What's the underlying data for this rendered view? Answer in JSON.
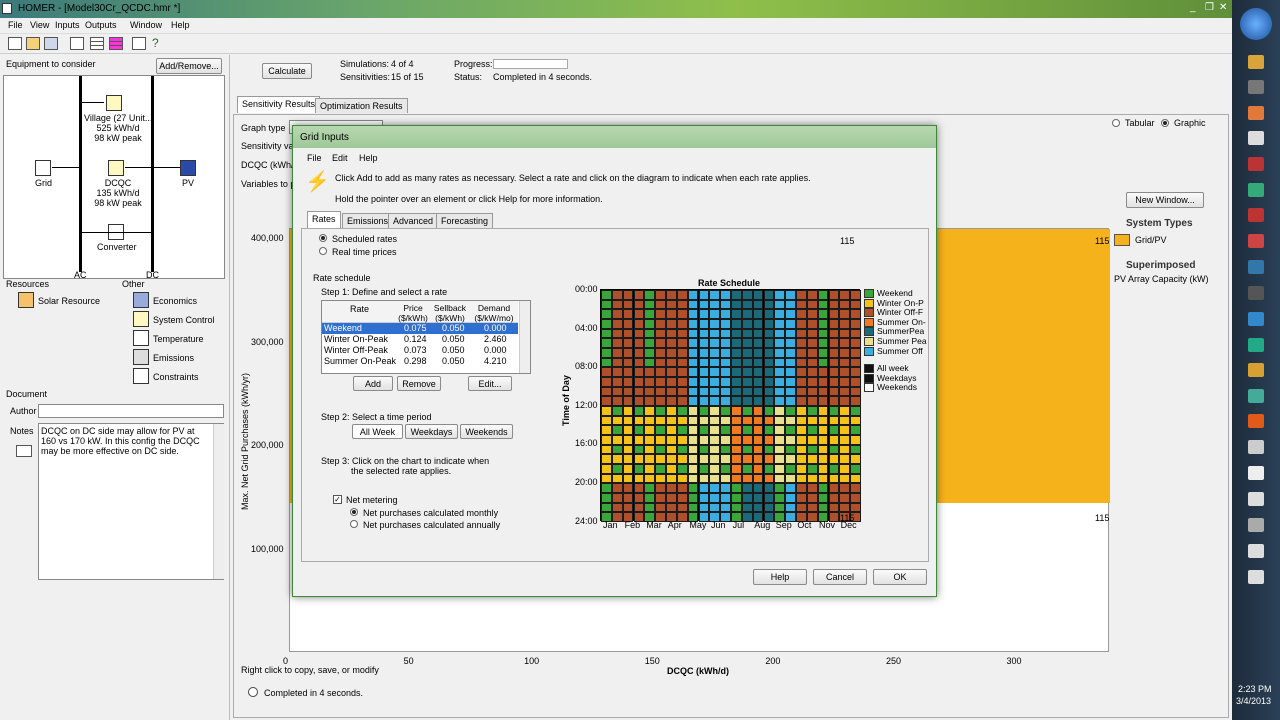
{
  "window": {
    "title": "HOMER - [Model30Cr_QCDC.hmr *]"
  },
  "menu": [
    "File",
    "View",
    "Inputs",
    "Outputs",
    "Window",
    "Help"
  ],
  "left": {
    "equipment_label": "Equipment to consider",
    "add_remove": "Add/Remove...",
    "nodes": {
      "village": [
        "Village (27 Unit...",
        "525 kWh/d",
        "98 kW peak"
      ],
      "dcqc": [
        "DCQC",
        "135 kWh/d",
        "98 kW peak"
      ],
      "grid": "Grid",
      "pv": "PV",
      "converter": "Converter",
      "ac": "AC",
      "dc": "DC"
    },
    "resources_label": "Resources",
    "other_label": "Other",
    "resources": [
      "Solar Resource"
    ],
    "other": [
      "Economics",
      "System Control",
      "Temperature",
      "Emissions",
      "Constraints"
    ],
    "document_label": "Document",
    "author_label": "Author",
    "notes_label": "Notes",
    "notes_text": "DCQC on DC side may allow for PV at 160 vs 170 kW.  In this config the DCQC may be more effective on DC side."
  },
  "top": {
    "calculate": "Calculate",
    "simulations_label": "Simulations:",
    "simulations": "4 of 4",
    "sensitivities_label": "Sensitivities:",
    "sensitivities": "15 of 15",
    "progress_label": "Progress:",
    "status_label": "Status:",
    "status": "Completed in 4 seconds."
  },
  "results": {
    "tabs": [
      "Sensitivity Results",
      "Optimization Results"
    ],
    "graph_type_label": "Graph type",
    "sens_var_label": "Sensitivity var",
    "dcqc_label": "DCQC (kWh/",
    "vars_plot_label": "Variables to pl",
    "view_tabular": "Tabular",
    "view_graphic": "Graphic",
    "new_window": "New Window...",
    "system_types_title": "System Types",
    "system_types": [
      "Grid/PV"
    ],
    "superimposed_title": "Superimposed",
    "superimposed_value": "PV Array Capacity (kW)",
    "footer_hint": "Right click to copy, save, or modify",
    "status_bar": "Completed in 4 seconds."
  },
  "chart_data": {
    "type": "area",
    "xlabel": "DCQC (kWh/d)",
    "ylabel": "Max. Net Grid Purchases (kWh/yr)",
    "x_ticks": [
      "0",
      "50",
      "100",
      "150",
      "200",
      "250",
      "300"
    ],
    "y_ticks": [
      "100,000",
      "200,000",
      "300,000",
      "400,000"
    ],
    "xlim": [
      0,
      340
    ],
    "ylim": [
      0,
      410000
    ],
    "series": [
      {
        "name": "Grid/PV",
        "color": "#f5b21a"
      }
    ],
    "contour_labels": [
      "115",
      "115",
      "115",
      "115"
    ]
  },
  "dialog": {
    "title": "Grid Inputs",
    "menu": [
      "File",
      "Edit",
      "Help"
    ],
    "hint1": "Click Add to add as many rates as necessary.  Select a rate and click on the diagram to indicate when each rate applies.",
    "hint2": "Hold the pointer over an element or click Help for more information.",
    "tabs": [
      "Rates",
      "Emissions",
      "Advanced",
      "Forecasting"
    ],
    "scheduled": "Scheduled rates",
    "realtime": "Real time prices",
    "rate_schedule": "Rate schedule",
    "step1": "Step 1:  Define and select a rate",
    "table_headers": [
      "Rate",
      "Price ($/kWh)",
      "Sellback ($/kWh)",
      "Demand ($/kW/mo)"
    ],
    "rates": [
      [
        "Weekend",
        "0.075",
        "0.050",
        "0.000"
      ],
      [
        "Winter On-Peak",
        "0.124",
        "0.050",
        "2.460"
      ],
      [
        "Winter Off-Peak",
        "0.073",
        "0.050",
        "0.000"
      ],
      [
        "Summer On-Peak",
        "0.298",
        "0.050",
        "4.210"
      ]
    ],
    "add": "Add",
    "remove": "Remove",
    "edit": "Edit...",
    "step2": "Step 2:  Select a time period",
    "periods": [
      "All Week",
      "Weekdays",
      "Weekends"
    ],
    "step3a": "Step 3:  Click on the chart to indicate when",
    "step3b": "the selected rate applies.",
    "net_metering": "Net metering",
    "net_monthly": "Net purchases calculated monthly",
    "net_annually": "Net purchases calculated annually",
    "schedule_title": "Rate Schedule",
    "time_axis": "Time of Day",
    "hours": [
      "00:00",
      "04:00",
      "08:00",
      "12:00",
      "16:00",
      "20:00",
      "24:00"
    ],
    "months": [
      "Jan",
      "Feb",
      "Mar",
      "Apr",
      "May",
      "Jun",
      "Jul",
      "Aug",
      "Sep",
      "Oct",
      "Nov",
      "Dec"
    ],
    "legend": [
      "Weekend",
      "Winter On-P",
      "Winter Off-F",
      "Summer On-",
      "SummerPea",
      "Summer Pea",
      "Summer Off"
    ],
    "legend_colors": [
      "#3aa63a",
      "#f5c21a",
      "#b0502a",
      "#f07a20",
      "#1a6a7a",
      "#e8e08a",
      "#3aaee0"
    ],
    "legend2": [
      "All week",
      "Weekdays",
      "Weekends"
    ],
    "help": "Help",
    "cancel": "Cancel",
    "ok": "OK"
  },
  "taskbar": {
    "time": "2:23 PM",
    "date": "3/4/2013"
  }
}
